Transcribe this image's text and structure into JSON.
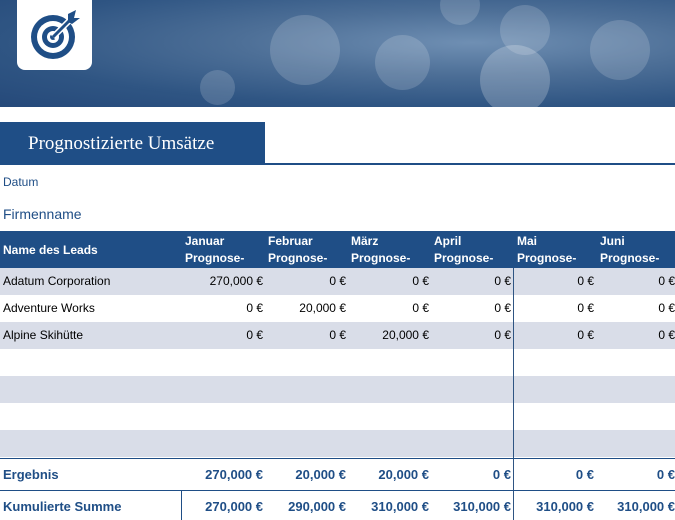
{
  "header": {
    "title": "Prognostizierte Umsätze",
    "logo_icon": "target-icon",
    "colors": {
      "primary": "#1f4e86",
      "alt_row": "#d9dde8"
    }
  },
  "fields": {
    "datum_label": "Datum",
    "firma_label": "Firmenname"
  },
  "table": {
    "name_header": "Name des Leads",
    "months": [
      {
        "line1": "Januar",
        "line2": "Prognose-"
      },
      {
        "line1": "Februar",
        "line2": "Prognose-"
      },
      {
        "line1": "März",
        "line2": "Prognose-"
      },
      {
        "line1": "April",
        "line2": "Prognose-"
      },
      {
        "line1": "Mai",
        "line2": "Prognose-"
      },
      {
        "line1": "Juni",
        "line2": "Prognose-"
      }
    ],
    "rows": [
      {
        "name": "Adatum Corporation",
        "values": [
          "270,000 €",
          "0 €",
          "0 €",
          "0 €",
          "0 €",
          "0 €"
        ]
      },
      {
        "name": "Adventure Works",
        "values": [
          "0 €",
          "20,000 €",
          "0 €",
          "0 €",
          "0 €",
          "0 €"
        ]
      },
      {
        "name": "Alpine Skihütte",
        "values": [
          "0 €",
          "0 €",
          "20,000 €",
          "0 €",
          "0 €",
          "0 €"
        ]
      }
    ],
    "totals": {
      "label": "Ergebnis",
      "values": [
        "270,000 €",
        "20,000 €",
        "20,000 €",
        "0 €",
        "0 €",
        "0 €"
      ]
    },
    "cumulative": {
      "label": "Kumulierte Summe",
      "values": [
        "270,000 €",
        "290,000 €",
        "310,000 €",
        "310,000 €",
        "310,000 €",
        "310,000 €"
      ]
    }
  }
}
